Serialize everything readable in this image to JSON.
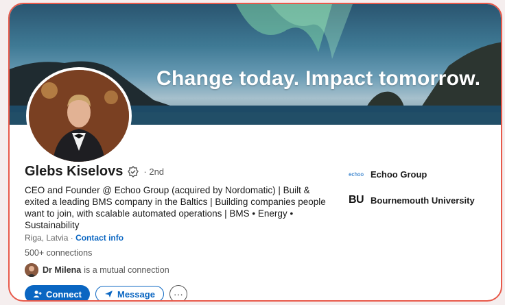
{
  "banner": {
    "text": "Change today. Impact tomorrow."
  },
  "profile": {
    "name": "Glebs Kiselovs",
    "degree": "· 2nd",
    "headline": "CEO and Founder @ Echoo Group (acquired by Nordomatic) | Built & exited a leading BMS company in the Baltics | Building companies people want to join, with scalable automated operations | BMS • Energy • Sustainability",
    "location": "Riga, Latvia",
    "contact_label": "Contact info",
    "connections": "500+ connections",
    "mutual_name": "Dr Milena",
    "mutual_text": "is a mutual connection"
  },
  "actions": {
    "connect_label": "Connect",
    "message_label": "Message",
    "more_label": "···"
  },
  "experience": [
    {
      "logo_text": "echoo",
      "label": "Echoo Group"
    },
    {
      "logo_text": "BU",
      "label": "Bournemouth University"
    }
  ],
  "colors": {
    "accent": "#0a66c2",
    "frame": "#e8594a"
  }
}
